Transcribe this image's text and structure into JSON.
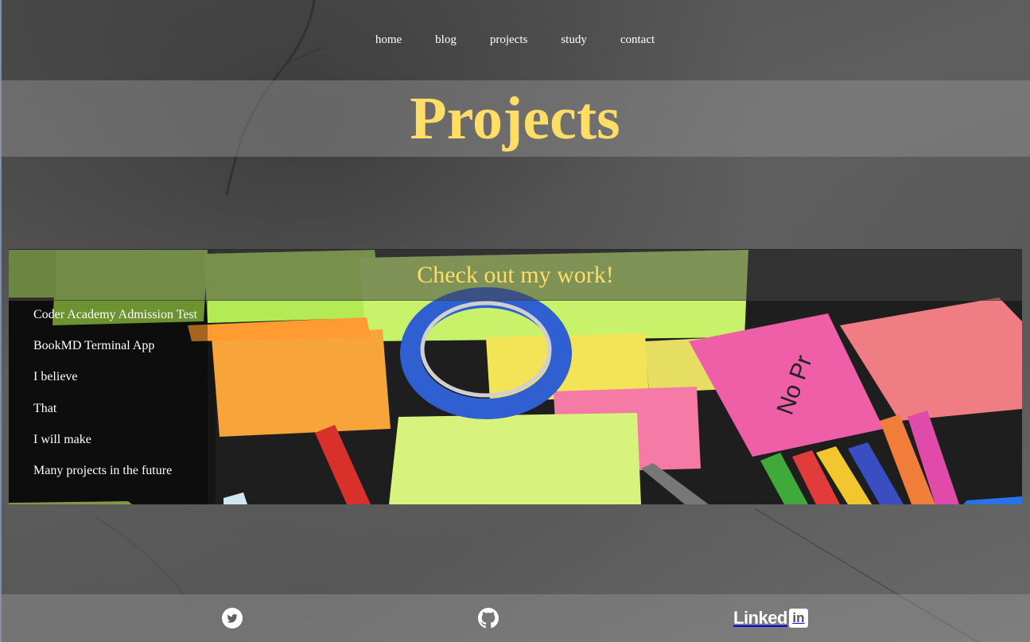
{
  "nav": {
    "items": [
      {
        "label": "home"
      },
      {
        "label": "blog"
      },
      {
        "label": "projects"
      },
      {
        "label": "study"
      },
      {
        "label": "contact"
      }
    ]
  },
  "page_title": "Projects",
  "projects": {
    "heading": "Check out my work!",
    "items": [
      {
        "label": "Coder Academy Admission Test"
      },
      {
        "label": "BookMD Terminal App"
      },
      {
        "label": "I believe"
      },
      {
        "label": "That"
      },
      {
        "label": "I will make"
      },
      {
        "label": "Many projects in the future"
      }
    ]
  },
  "footer": {
    "icons": [
      "twitter-icon",
      "github-icon",
      "linkedin-icon"
    ],
    "linkedin_text": "Linked",
    "linkedin_box": "in"
  },
  "colors": {
    "accent": "#ffdd66",
    "nav_text": "#ffffff",
    "band": "rgba(150,150,150,0.45)"
  }
}
